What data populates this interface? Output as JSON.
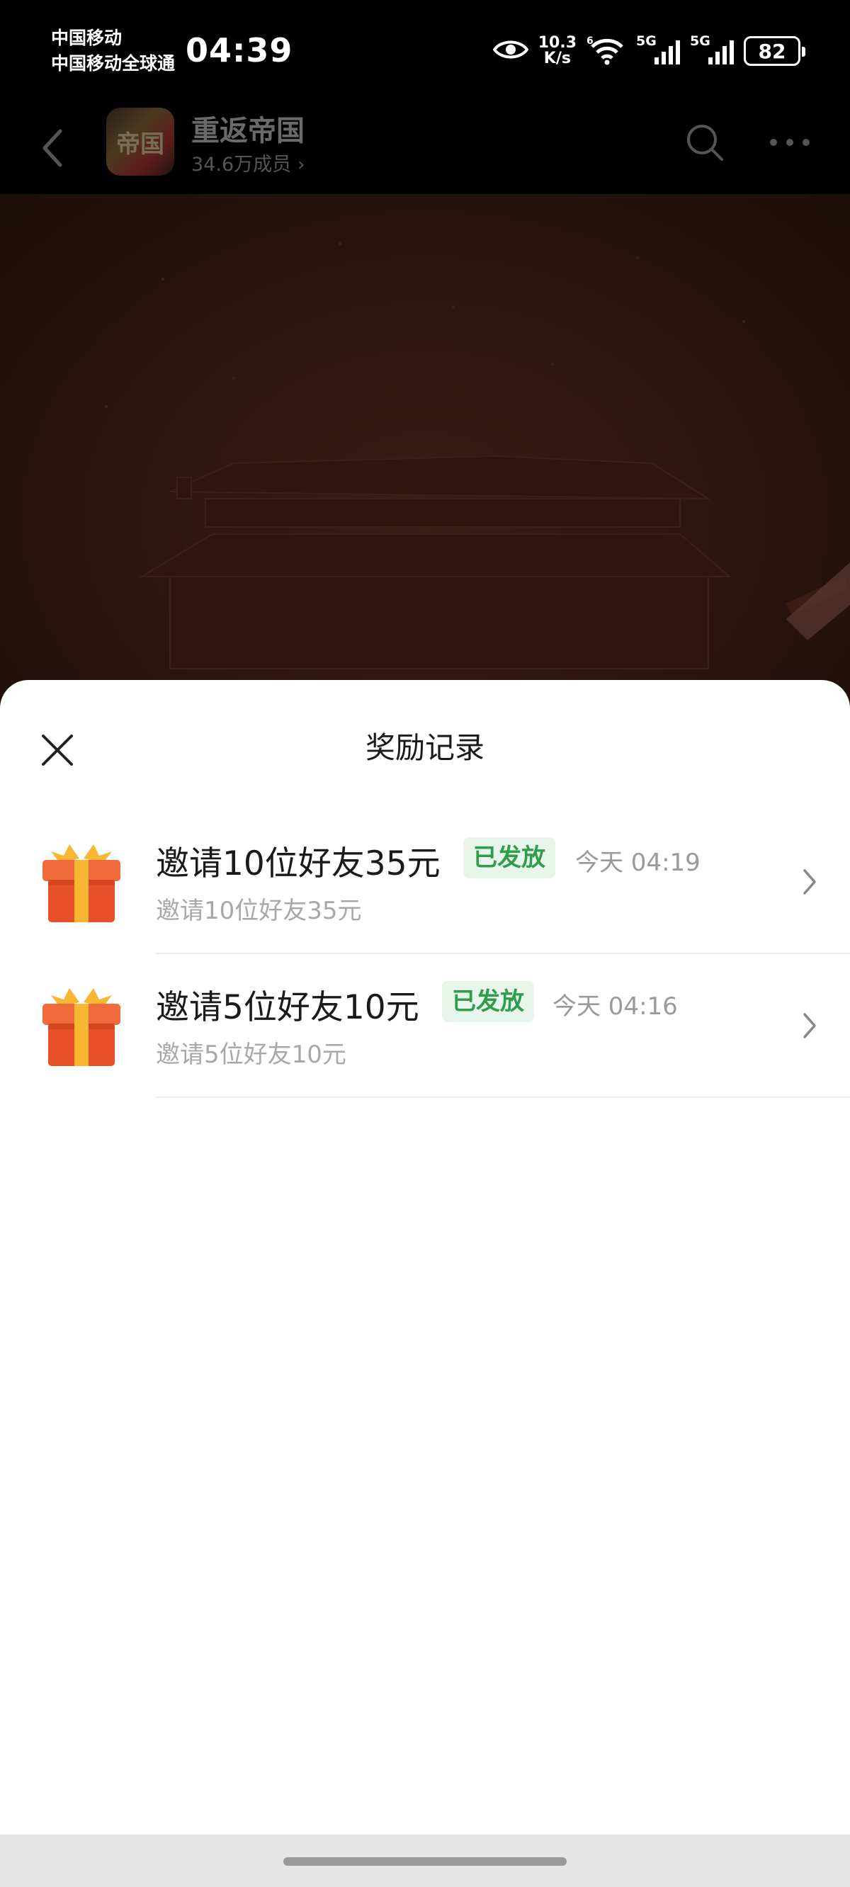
{
  "status_bar": {
    "carrier_1": "中国移动",
    "carrier_2": "中国移动全球通",
    "time": "04:39",
    "net_speed_value": "10.3",
    "net_speed_unit": "K/s",
    "sim1_tag": "5G",
    "sim2_tag": "5G",
    "battery": "82"
  },
  "header": {
    "avatar_text": "帝国",
    "group_name": "重返帝国",
    "member_count": "34.6万成员 ›"
  },
  "sheet": {
    "title": "奖励记录",
    "records": [
      {
        "title": "邀请10位好友35元",
        "status": "已发放",
        "time": "今天 04:19",
        "subtitle": "邀请10位好友35元"
      },
      {
        "title": "邀请5位好友10元",
        "status": "已发放",
        "time": "今天 04:16",
        "subtitle": "邀请5位好友10元"
      }
    ]
  },
  "colors": {
    "badge_text": "#2f9e4c",
    "badge_bg": "#e8f5ea",
    "gift_red": "#e8502a",
    "gift_ribbon": "#f7b733"
  }
}
